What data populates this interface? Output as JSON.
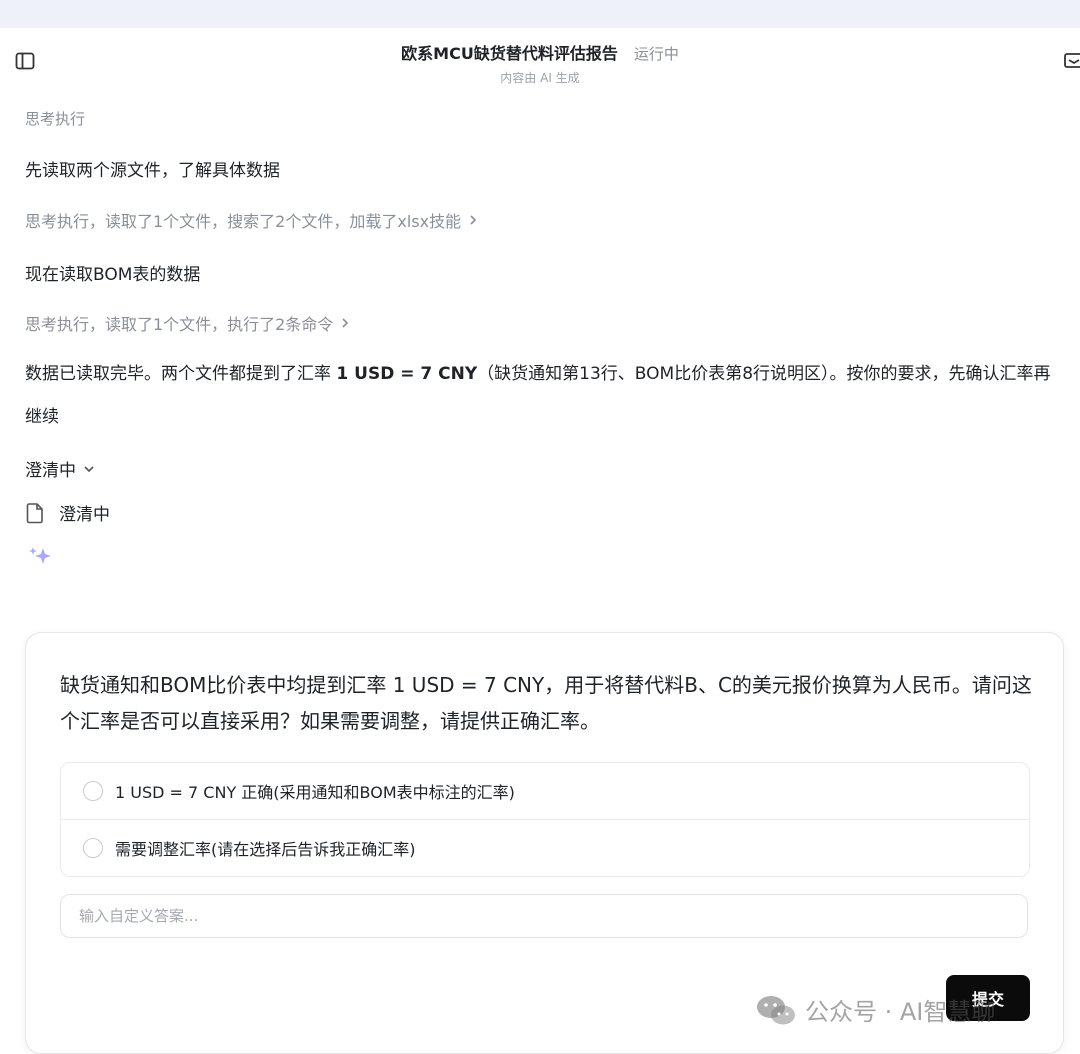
{
  "header": {
    "title": "欧系MCU缺货替代料评估报告",
    "status": "运行中",
    "subtitle": "内容由 AI 生成"
  },
  "feed": {
    "clipped_step": "思考执行",
    "line1": "先读取两个源文件，了解具体数据",
    "step1": "思考执行，读取了1个文件，搜索了2个文件，加载了xlsx技能",
    "line2": "现在读取BOM表的数据",
    "step2": "思考执行，读取了1个文件，执行了2条命令",
    "para_part1": "数据已读取完毕。两个文件都提到了汇率 ",
    "para_bold": "1 USD = 7 CNY",
    "para_part2": "（缺货通知第13行、BOM比价表第8行说明区）。按你的要求，先确认汇率再继续",
    "clarify_label": "澄清中",
    "clarify_file": "澄清中"
  },
  "card": {
    "question": "缺货通知和BOM比价表中均提到汇率 1 USD = 7 CNY，用于将替代料B、C的美元报价换算为人民币。请问这个汇率是否可以直接采用？如果需要调整，请提供正确汇率。",
    "options": [
      {
        "label": "1 USD = 7 CNY 正确(采用通知和BOM表中标注的汇率)"
      },
      {
        "label": "需要调整汇率(请在选择后告诉我正确汇率)"
      }
    ],
    "input_placeholder": "输入自定义答案...",
    "submit_label": "提交"
  },
  "watermark": {
    "text": "公众号 · AI智慧聊"
  },
  "icons": {
    "sidebar": "sidebar-toggle-icon",
    "share": "share-icon",
    "chevron_right": "chevron-right-icon",
    "chevron_down": "chevron-down-icon",
    "file": "file-icon",
    "sparkle": "sparkle-icon",
    "wechat": "wechat-icon"
  }
}
